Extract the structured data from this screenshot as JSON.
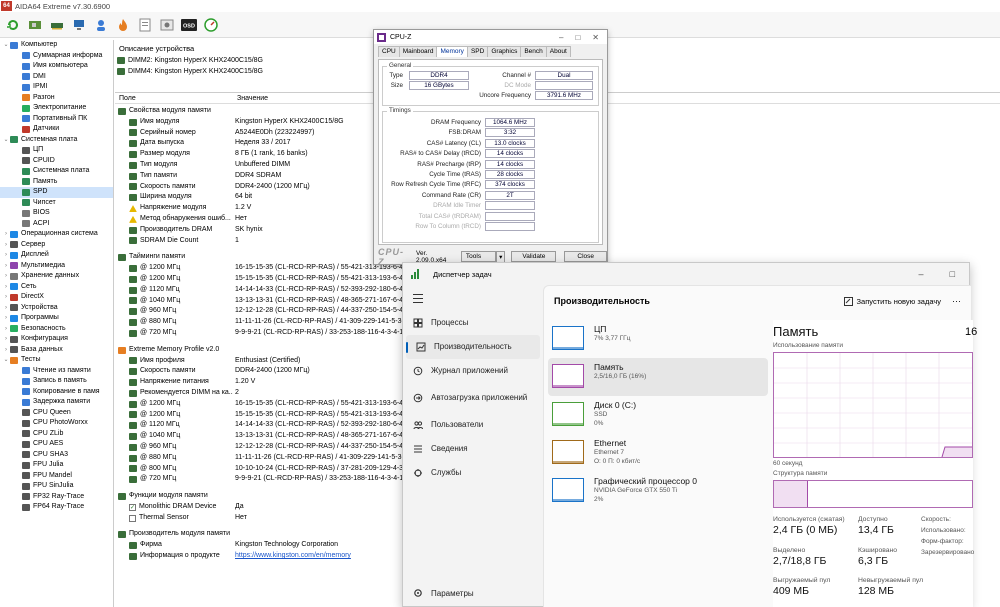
{
  "aida": {
    "title": "AIDA64 Extreme v7.30.6900",
    "logo": "64",
    "tree": [
      {
        "label": "Компьютер",
        "level": 0,
        "arrow": "⌄",
        "color": "#3a7bd5"
      },
      {
        "label": "Суммарная информа",
        "level": 1,
        "color": "#3a7bd5"
      },
      {
        "label": "Имя компьютера",
        "level": 1,
        "color": "#3a7bd5"
      },
      {
        "label": "DMI",
        "level": 1,
        "color": "#3a7bd5"
      },
      {
        "label": "IPMI",
        "level": 1,
        "color": "#3a7bd5"
      },
      {
        "label": "Разгон",
        "level": 1,
        "color": "#e67e22"
      },
      {
        "label": "Электропитание",
        "level": 1,
        "color": "#27ae60"
      },
      {
        "label": "Портативный ПК",
        "level": 1,
        "color": "#3a7bd5"
      },
      {
        "label": "Датчики",
        "level": 1,
        "color": "#c0392b"
      },
      {
        "label": "Системная плата",
        "level": 0,
        "arrow": "⌄",
        "color": "#2e8b57"
      },
      {
        "label": "ЦП",
        "level": 1,
        "color": "#555"
      },
      {
        "label": "CPUID",
        "level": 1,
        "color": "#555"
      },
      {
        "label": "Системная плата",
        "level": 1,
        "color": "#2e8b57"
      },
      {
        "label": "Память",
        "level": 1,
        "color": "#2e8b57"
      },
      {
        "label": "SPD",
        "level": 1,
        "color": "#2e8b57",
        "selected": true
      },
      {
        "label": "Чипсет",
        "level": 1,
        "color": "#2e8b57"
      },
      {
        "label": "BIOS",
        "level": 1,
        "color": "#777"
      },
      {
        "label": "ACPI",
        "level": 1,
        "color": "#777"
      },
      {
        "label": "Операционная система",
        "level": 0,
        "arrow": "›",
        "color": "#1e88e5"
      },
      {
        "label": "Сервер",
        "level": 0,
        "arrow": "›",
        "color": "#555"
      },
      {
        "label": "Дисплей",
        "level": 0,
        "arrow": "›",
        "color": "#1e88e5"
      },
      {
        "label": "Мультимедиа",
        "level": 0,
        "arrow": "›",
        "color": "#8e44ad"
      },
      {
        "label": "Хранение данных",
        "level": 0,
        "arrow": "›",
        "color": "#777"
      },
      {
        "label": "Сеть",
        "level": 0,
        "arrow": "›",
        "color": "#1e88e5"
      },
      {
        "label": "DirectX",
        "level": 0,
        "arrow": "›",
        "color": "#c0392b"
      },
      {
        "label": "Устройства",
        "level": 0,
        "arrow": "›",
        "color": "#555"
      },
      {
        "label": "Программы",
        "level": 0,
        "arrow": "›",
        "color": "#1e88e5"
      },
      {
        "label": "Безопасность",
        "level": 0,
        "arrow": "›",
        "color": "#27ae60"
      },
      {
        "label": "Конфигурация",
        "level": 0,
        "arrow": "›",
        "color": "#555"
      },
      {
        "label": "База данных",
        "level": 0,
        "arrow": "›",
        "color": "#555"
      },
      {
        "label": "Тесты",
        "level": 0,
        "arrow": "⌄",
        "color": "#e67e22"
      },
      {
        "label": "Чтение из памяти",
        "level": 1,
        "color": "#3a7bd5"
      },
      {
        "label": "Запись в память",
        "level": 1,
        "color": "#3a7bd5"
      },
      {
        "label": "Копирование в памя",
        "level": 1,
        "color": "#3a7bd5"
      },
      {
        "label": "Задержка памяти",
        "level": 1,
        "color": "#3a7bd5"
      },
      {
        "label": "CPU Queen",
        "level": 1,
        "color": "#555"
      },
      {
        "label": "CPU PhotoWorxx",
        "level": 1,
        "color": "#555"
      },
      {
        "label": "CPU ZLib",
        "level": 1,
        "color": "#555"
      },
      {
        "label": "CPU AES",
        "level": 1,
        "color": "#555"
      },
      {
        "label": "CPU SHA3",
        "level": 1,
        "color": "#555"
      },
      {
        "label": "FPU Julia",
        "level": 1,
        "color": "#555"
      },
      {
        "label": "FPU Mandel",
        "level": 1,
        "color": "#555"
      },
      {
        "label": "FPU SinJulia",
        "level": 1,
        "color": "#555"
      },
      {
        "label": "FP32 Ray-Trace",
        "level": 1,
        "color": "#555"
      },
      {
        "label": "FP64 Ray-Trace",
        "level": 1,
        "color": "#555"
      }
    ],
    "device_header": "Описание устройства",
    "devices": [
      "DIMM2: Kingston HyperX KHX2400C15/8G",
      "DIMM4: Kingston HyperX KHX2400C15/8G"
    ],
    "col_field": "Поле",
    "col_value": "Значение",
    "rows": [
      {
        "type": "sec",
        "f": "Свойства модуля памяти"
      },
      {
        "f": "Имя модуля",
        "v": "Kingston HyperX KHX2400C15/8G"
      },
      {
        "f": "Серийный номер",
        "v": "A5244E0Dh (223224997)"
      },
      {
        "f": "Дата выпуска",
        "v": "Неделя 33 / 2017"
      },
      {
        "f": "Размер модуля",
        "v": "8 ГБ (1 rank, 16 banks)"
      },
      {
        "f": "Тип модуля",
        "v": "Unbuffered DIMM"
      },
      {
        "f": "Тип памяти",
        "v": "DDR4 SDRAM"
      },
      {
        "f": "Скорость памяти",
        "v": "DDR4-2400 (1200 МГц)"
      },
      {
        "f": "Ширина модуля",
        "v": "64 bit"
      },
      {
        "f": "Напряжение модуля",
        "v": "1.2 V",
        "warn": true
      },
      {
        "f": "Метод обнаружения ошиб...",
        "v": "Нет",
        "warn": true
      },
      {
        "f": "Производитель DRAM",
        "v": "SK hynix"
      },
      {
        "f": "SDRAM Die Count",
        "v": "1"
      },
      {
        "type": "gap"
      },
      {
        "type": "sec",
        "f": "Тайминги памяти"
      },
      {
        "f": "@ 1200 МГц",
        "v": "16-15-15-35  (CL-RCD-RP-RAS) / 55-421-313-193-6-4-4..."
      },
      {
        "f": "@ 1200 МГц",
        "v": "15-15-15-35  (CL-RCD-RP-RAS) / 55-421-313-193-6-4-4..."
      },
      {
        "f": "@ 1120 МГц",
        "v": "14-14-14-33  (CL-RCD-RP-RAS) / 52-393-292-180-6-4-4..."
      },
      {
        "f": "@ 1040 МГц",
        "v": "13-13-13-31  (CL-RCD-RP-RAS) / 48-365-271-167-6-4-4..."
      },
      {
        "f": "@ 960 МГц",
        "v": "12-12-12-28  (CL-RCD-RP-RAS) / 44-337-250-154-5-4-4..."
      },
      {
        "f": "@ 880 МГц",
        "v": "11-11-11-26  (CL-RCD-RP-RAS) / 41-309-229-141-5-3-3..."
      },
      {
        "f": "@ 720 МГц",
        "v": "9-9-9-21  (CL-RCD-RP-RAS) / 33-253-188-116-4-3-4-16"
      },
      {
        "type": "gap"
      },
      {
        "type": "sec",
        "f": "Extreme Memory Profile v2.0",
        "xmp": true
      },
      {
        "f": "Имя профиля",
        "v": "Enthusiast (Certified)"
      },
      {
        "f": "Скорость памяти",
        "v": "DDR4-2400 (1200 МГц)"
      },
      {
        "f": "Напряжение питания",
        "v": "1.20 V"
      },
      {
        "f": "Рекомендуется DIMM на ка...",
        "v": "2"
      },
      {
        "f": "@ 1200 МГц",
        "v": "16-15-15-35  (CL-RCD-RP-RAS) / 55-421-313-193-6-4-4..."
      },
      {
        "f": "@ 1200 МГц",
        "v": "15-15-15-35  (CL-RCD-RP-RAS) / 55-421-313-193-6-4-4..."
      },
      {
        "f": "@ 1120 МГц",
        "v": "14-14-14-33  (CL-RCD-RP-RAS) / 52-393-292-180-6-4-4..."
      },
      {
        "f": "@ 1040 МГц",
        "v": "13-13-13-31  (CL-RCD-RP-RAS) / 48-365-271-167-6-4-4..."
      },
      {
        "f": "@ 960 МГц",
        "v": "12-12-12-28  (CL-RCD-RP-RAS) / 44-337-250-154-5-4-4..."
      },
      {
        "f": "@ 880 МГц",
        "v": "11-11-11-26  (CL-RCD-RP-RAS) / 41-309-229-141-5-3-3..."
      },
      {
        "f": "@ 800 МГц",
        "v": "10-10-10-24  (CL-RCD-RP-RAS) / 37-281-209-129-4-3-3..."
      },
      {
        "f": "@ 720 МГц",
        "v": "9-9-9-21  (CL-RCD-RP-RAS) / 33-253-188-116-4-3-4-16"
      },
      {
        "type": "gap"
      },
      {
        "type": "sec",
        "f": "Функции модуля памяти"
      },
      {
        "f": "Monolithic DRAM Device",
        "v": "Да",
        "check": true
      },
      {
        "f": "Thermal Sensor",
        "v": "Нет",
        "check": false
      },
      {
        "type": "gap"
      },
      {
        "type": "sec",
        "f": "Производитель модуля памяти"
      },
      {
        "f": "Фирма",
        "v": "Kingston Technology Corporation"
      },
      {
        "f": "Информация о продукте",
        "v": "https://www.kingston.com/en/memory",
        "link": true
      }
    ]
  },
  "cpuz": {
    "title": "CPU-Z",
    "tabs": [
      "CPU",
      "Mainboard",
      "Memory",
      "SPD",
      "Graphics",
      "Bench",
      "About"
    ],
    "active_tab": "Memory",
    "general_label": "General",
    "type_label": "Type",
    "type_value": "DDR4",
    "size_label": "Size",
    "size_value": "16 GBytes",
    "channel_label": "Channel #",
    "channel_value": "Dual",
    "dcmode_label": "DC Mode",
    "uncore_label": "Uncore Frequency",
    "uncore_value": "3791.6 MHz",
    "timings_label": "Timings",
    "timings": [
      {
        "label": "DRAM Frequency",
        "value": "1064.6 MHz"
      },
      {
        "label": "FSB:DRAM",
        "value": "3:32"
      },
      {
        "label": "CAS# Latency (CL)",
        "value": "13.0 clocks"
      },
      {
        "label": "RAS# to CAS# Delay (tRCD)",
        "value": "14 clocks"
      },
      {
        "label": "RAS# Precharge (tRP)",
        "value": "14 clocks"
      },
      {
        "label": "Cycle Time (tRAS)",
        "value": "28 clocks"
      },
      {
        "label": "Row Refresh Cycle Time (tRFC)",
        "value": "374 clocks"
      },
      {
        "label": "Command Rate (CR)",
        "value": "2T"
      },
      {
        "label": "DRAM Idle Timer",
        "value": ""
      },
      {
        "label": "Total CAS# (tRDRAM)",
        "value": ""
      },
      {
        "label": "Row To Column (tRCD)",
        "value": ""
      }
    ],
    "brand": "CPU-Z",
    "version": "Ver. 2.09.0.x64",
    "tools": "Tools",
    "validate": "Validate",
    "close": "Close"
  },
  "tm": {
    "title": "Диспетчер задач",
    "nav": [
      {
        "label": "Процессы",
        "icon": "grid-icon"
      },
      {
        "label": "Производительность",
        "icon": "chart-icon",
        "active": true
      },
      {
        "label": "Журнал приложений",
        "icon": "history-icon"
      },
      {
        "label": "Автозагрузка приложений",
        "icon": "startup-icon"
      },
      {
        "label": "Пользователи",
        "icon": "users-icon"
      },
      {
        "label": "Сведения",
        "icon": "list-icon"
      },
      {
        "label": "Службы",
        "icon": "services-icon"
      }
    ],
    "settings": "Параметры",
    "section_title": "Производительность",
    "run_task": "Запустить новую задачу",
    "more": "···",
    "items": [
      {
        "name": "ЦП",
        "sub1": "7% 3,77 ГГц",
        "sub2": "",
        "color": "#1a73c8"
      },
      {
        "name": "Память",
        "sub1": "2,5/16,0 ГБ (16%)",
        "sub2": "",
        "color": "#a34aa8",
        "active": true
      },
      {
        "name": "Диск 0 (C:)",
        "sub1": "SSD",
        "sub2": "0%",
        "color": "#4a9e3a"
      },
      {
        "name": "Ethernet",
        "sub1": "Ethernet 7",
        "sub2": "О: 0 П: 0 кбит/с",
        "color": "#a06a1a"
      },
      {
        "name": "Графический процессор 0",
        "sub1": "NVIDIA GeForce GTX 550 Ti",
        "sub2": "2%",
        "color": "#1a73c8"
      }
    ],
    "mem_title": "Память",
    "mem_cut": "16",
    "usage_label": "Использование памяти",
    "seconds_label": "60 секунд",
    "structure_label": "Структура памяти",
    "stats": [
      {
        "k": "Используется (сжатая)",
        "v": "2,4 ГБ (0 МБ)"
      },
      {
        "k": "Доступно",
        "v": "13,4 ГБ"
      },
      {
        "k": "Выделено",
        "v": "2,7/18,8 ГБ"
      },
      {
        "k": "Кэшировано",
        "v": "6,3 ГБ"
      },
      {
        "k": "Выгружаемый пул",
        "v": "409 МБ"
      },
      {
        "k": "Невыгружаемый пул",
        "v": "128 МБ"
      }
    ],
    "right_labels": [
      "Скорость:",
      "Использовано:",
      "Форм-фактор:",
      "Зарезервировано"
    ]
  }
}
